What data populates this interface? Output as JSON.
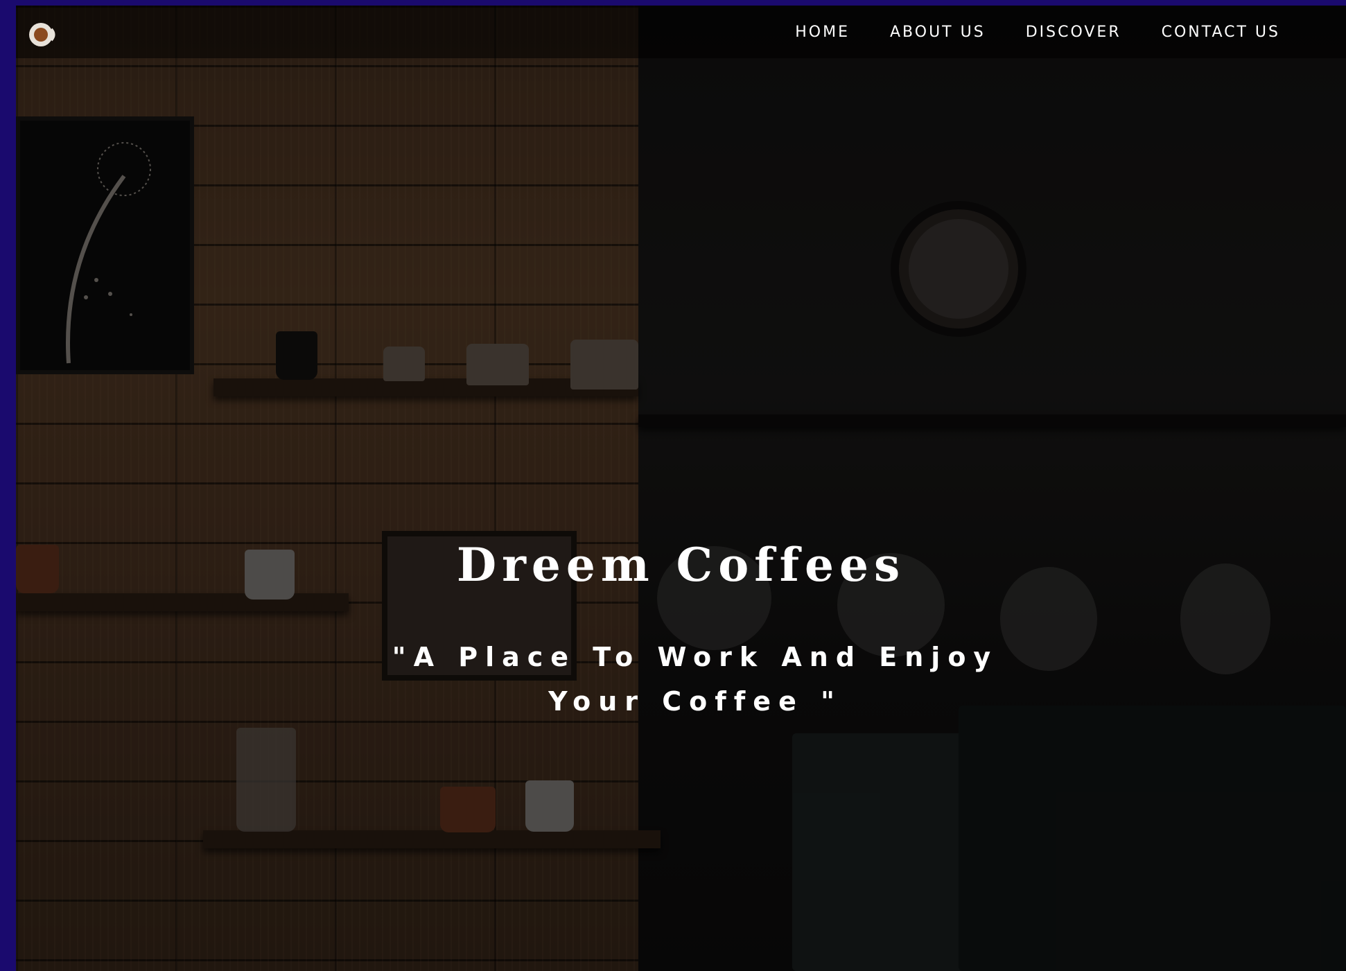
{
  "nav": {
    "logo_icon": "coffee-cup-icon",
    "items": [
      {
        "label": "HOME"
      },
      {
        "label": "ABOUT US"
      },
      {
        "label": "DISCOVER"
      },
      {
        "label": "CONTACT US"
      }
    ]
  },
  "hero": {
    "title": "Dreem Coffees",
    "tagline": "\"A Place To Work And Enjoy Your Coffee \""
  },
  "colors": {
    "frame_border": "#1a0a6e",
    "text": "#ffffff",
    "logo_cup": "#8b4a1f"
  }
}
